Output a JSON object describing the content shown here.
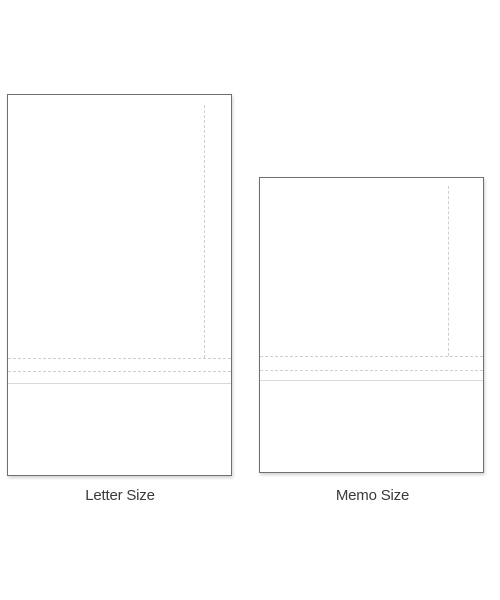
{
  "sheets": [
    {
      "label": "Letter Size"
    },
    {
      "label": "Memo Size"
    }
  ],
  "colors": {
    "sheet_border": "#6f6f6f",
    "perforation": "#cfcfcf",
    "label_text": "#3a3a3a"
  }
}
